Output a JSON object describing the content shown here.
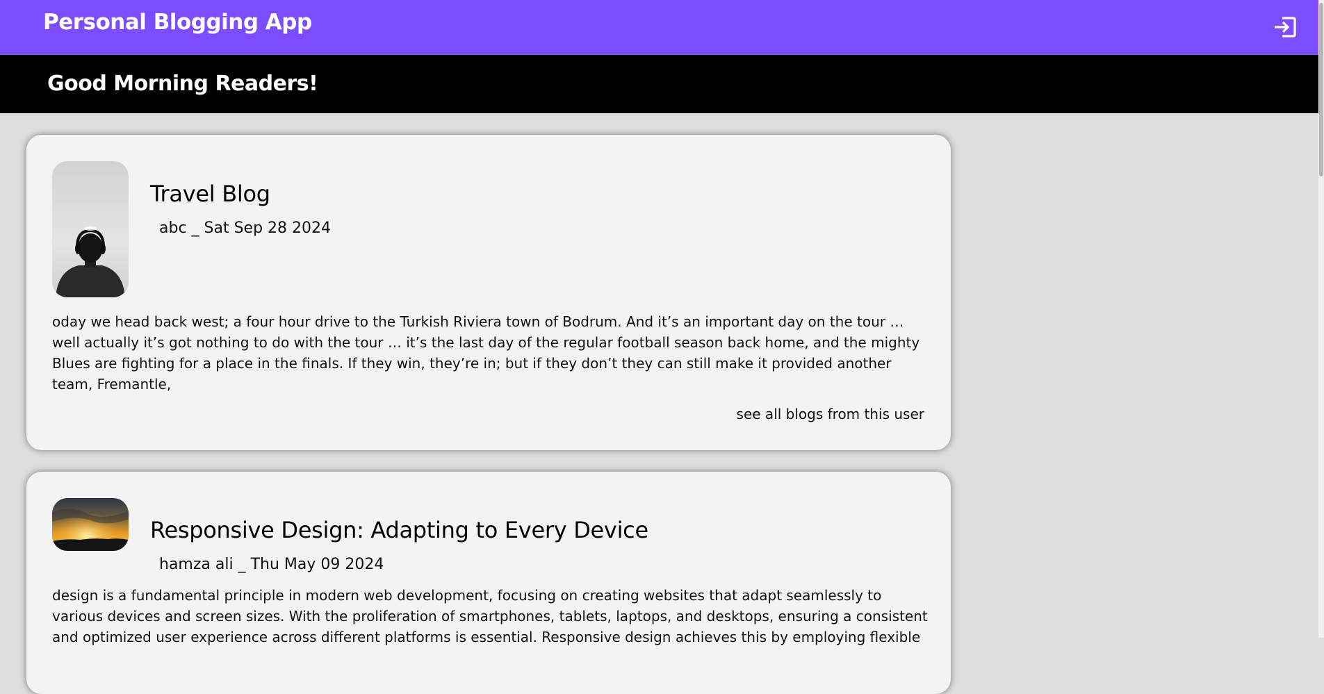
{
  "header": {
    "app_title": "Personal Blogging App",
    "logout_icon": "logout-icon",
    "color": "#7c4dff"
  },
  "greeting": "Good Morning Readers!",
  "posts": [
    {
      "title": "Travel Blog",
      "meta": "abc _ Sat Sep 28 2024",
      "excerpt": "oday we head back west; a four hour drive to the Turkish Riviera town of Bodrum. And it’s an important day on the tour … well actually it’s got nothing to do with the tour … it’s the last day of the regular football season back home, and the mighty Blues are fighting for a place in the finals. If they win, they’re in; but if they don’t they can still make it provided another team, Fremantle,",
      "see_all": "see all blogs from this user",
      "image": "person-with-headphones-photo"
    },
    {
      "title": "Responsive Design: Adapting to Every Device",
      "meta": "hamza ali _ Thu May 09 2024",
      "excerpt": "design is a fundamental principle in modern web development, focusing on creating websites that adapt seamlessly to various devices and screen sizes. With the proliferation of smartphones, tablets, laptops, and desktops, ensuring a consistent and optimized user experience across different platforms is essential. Responsive design achieves this by employing flexible",
      "image": "sunset-landscape-photo"
    }
  ]
}
